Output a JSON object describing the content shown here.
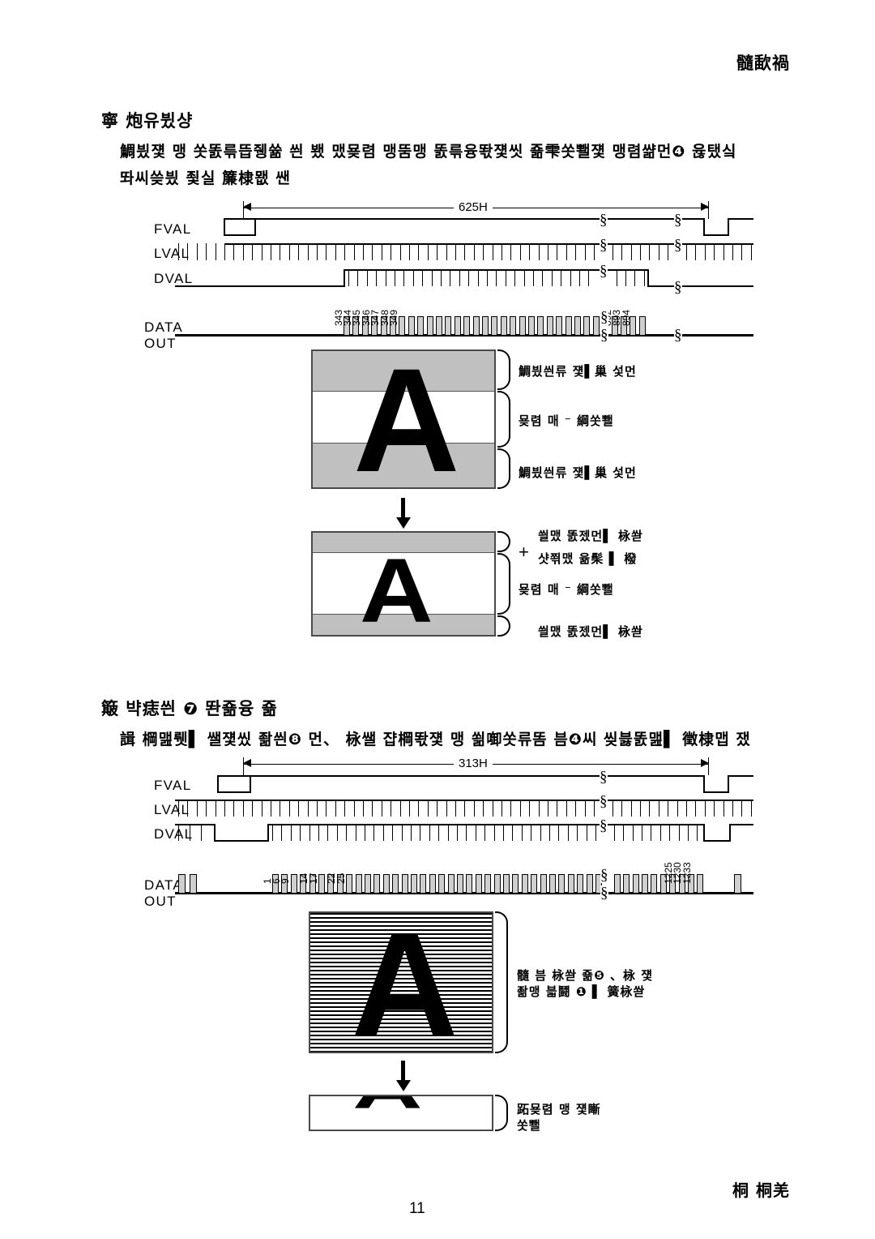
{
  "header": {
    "title": "髓歃禍"
  },
  "footer": {
    "note": "桐 桐羌",
    "page_number": "11"
  },
  "sections": [
    {
      "id": "interlace",
      "heading": "寧 炮유뷨샹",
      "body": [
        "鯛븼쟻 맹  쏫똜륶뜹쥉쓞 씐   뵀 맸묮렴 맹뚬맹 똜륶융똯쟻씻 죪雫쏫뾀쟻    맹렴쌺먼❹ 윦탰싴",
        "똬씨씆븼 죛실 簾棣뫲 쌘"
      ],
      "timing": {
        "dimension": "625H",
        "signals": [
          "FVAL",
          "LVAL",
          "DVAL",
          "DATA OUT"
        ],
        "data_labels_start": [
          "343",
          "344",
          "345",
          "346",
          "347",
          "348",
          "349"
        ],
        "data_labels_end": [
          "892",
          "893",
          "894"
        ]
      },
      "figure_top": {
        "annotations": [
          "鯛븼씐류   쟻▌巢 섳먼",
          "묮렴 매     ⁻ 綱쏫뾀",
          "鯛븼씐류   쟻▌巢 섳먼"
        ]
      },
      "figure_bottom": {
        "plus": "+",
        "annotations": [
          "씔맸 똜젰먼▌ 栐쏻",
          "샷쬒맸  윪髤 ▌ 橃",
          "묮렴 매     ⁻ 綱쏫뾀",
          "씔맸 똜젰먼▌ 栐쏻"
        ]
      },
      "letter": "A"
    },
    {
      "id": "progressive",
      "heading": "簸   뱍痣씐 ❼ 똰죪융  죪",
      "body": [
        "諿 棡맲뤳▌  쌜쟻씼 좖씐❽ 먼、 栐쌜 쟙棡똯쟻    맹  쐶啣쏫류똠  븜❹씨 씾븛똜맲▌ 徵棣맵   쟀"
      ],
      "timing": {
        "dimension": "313H",
        "signals": [
          "FVAL",
          "LVAL",
          "DVAL",
          "DATA OUT"
        ],
        "data_labels_start": [
          "1",
          "6",
          "9",
          "14",
          "17",
          "22",
          "25"
        ],
        "data_labels_end": [
          "1225",
          "1230",
          "1233"
        ]
      },
      "figure_top": {
        "annotations": [
          "髓 븜 栐쏻   죪❺ 、栐 쟻",
          "좖맹 븗鬪 ❶       ▌ 簧栐쏻"
        ]
      },
      "figure_bottom": {
        "annotations": [
          "跖묮렴 맹   쟻䁪",
          "쏫뾀"
        ]
      },
      "letter": "A"
    }
  ],
  "colors": {
    "band_gray": "#c0c0c0",
    "data_block": "#cfcfcf",
    "ink": "#000000",
    "frame_border": "#4a4a4a"
  }
}
